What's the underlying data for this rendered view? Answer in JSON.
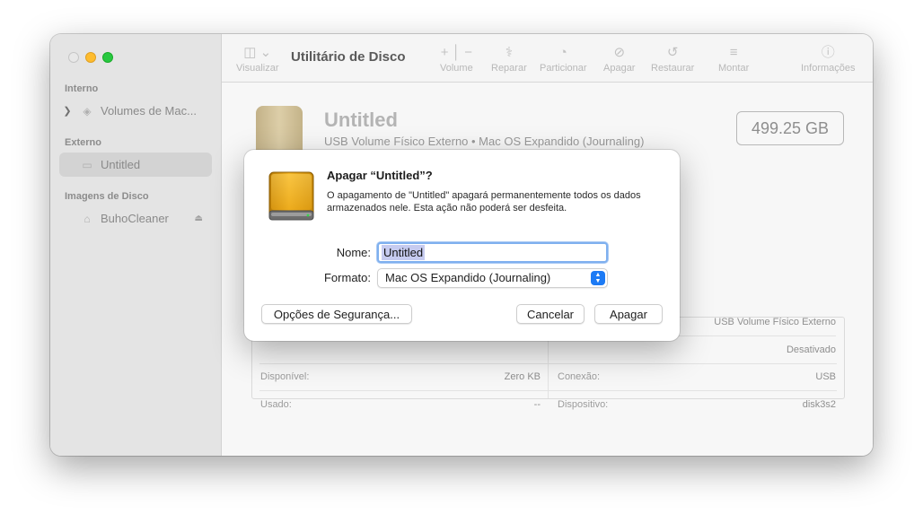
{
  "sidebar": {
    "sections": {
      "internal": "Interno",
      "external": "Externo",
      "images": "Imagens de Disco"
    },
    "items": {
      "internal_volume": "Volumes de Mac...",
      "external_volume": "Untitled",
      "image_volume": "BuhoCleaner"
    }
  },
  "toolbar": {
    "title": "Utilitário de Disco",
    "view_label": "Visualizar",
    "volume_label": "Volume",
    "repair_label": "Reparar",
    "partition_label": "Particionar",
    "erase_label": "Apagar",
    "restore_label": "Restaurar",
    "mount_label": "Montar",
    "info_label": "Informações"
  },
  "volume": {
    "name": "Untitled",
    "subtitle": "USB Volume Físico Externo • Mac OS Expandido (Journaling)",
    "capacity": "499.25 GB"
  },
  "info_table": {
    "row1_right_value": "USB Volume Físico Externo",
    "row2_right_value": "Desativado",
    "available_label": "Disponível:",
    "available_value": "Zero KB",
    "connection_label": "Conexão:",
    "connection_value": "USB",
    "used_label": "Usado:",
    "used_value": "--",
    "device_label": "Dispositivo:",
    "device_value": "disk3s2"
  },
  "dialog": {
    "title": "Apagar “Untitled”?",
    "message": "O apagamento de \"Untitled\" apagará permanentemente todos os dados armazenados nele. Esta ação não poderá ser desfeita.",
    "name_label": "Nome:",
    "name_value": "Untitled",
    "format_label": "Formato:",
    "format_value": "Mac OS Expandido (Journaling)",
    "security_button": "Opções de Segurança...",
    "cancel_button": "Cancelar",
    "erase_button": "Apagar"
  },
  "colors": {
    "accent": "#1d7bf5",
    "selection": "#c6cbf0",
    "drive_gold": "#e0a414"
  },
  "icons": [
    "sidebar-toggle-icon",
    "chevron-down-icon",
    "plus-icon",
    "minus-icon",
    "stethoscope-icon",
    "pie-chart-icon",
    "erase-icon",
    "restore-icon",
    "mount-icon",
    "info-icon",
    "external-drive-icon",
    "eject-icon"
  ]
}
